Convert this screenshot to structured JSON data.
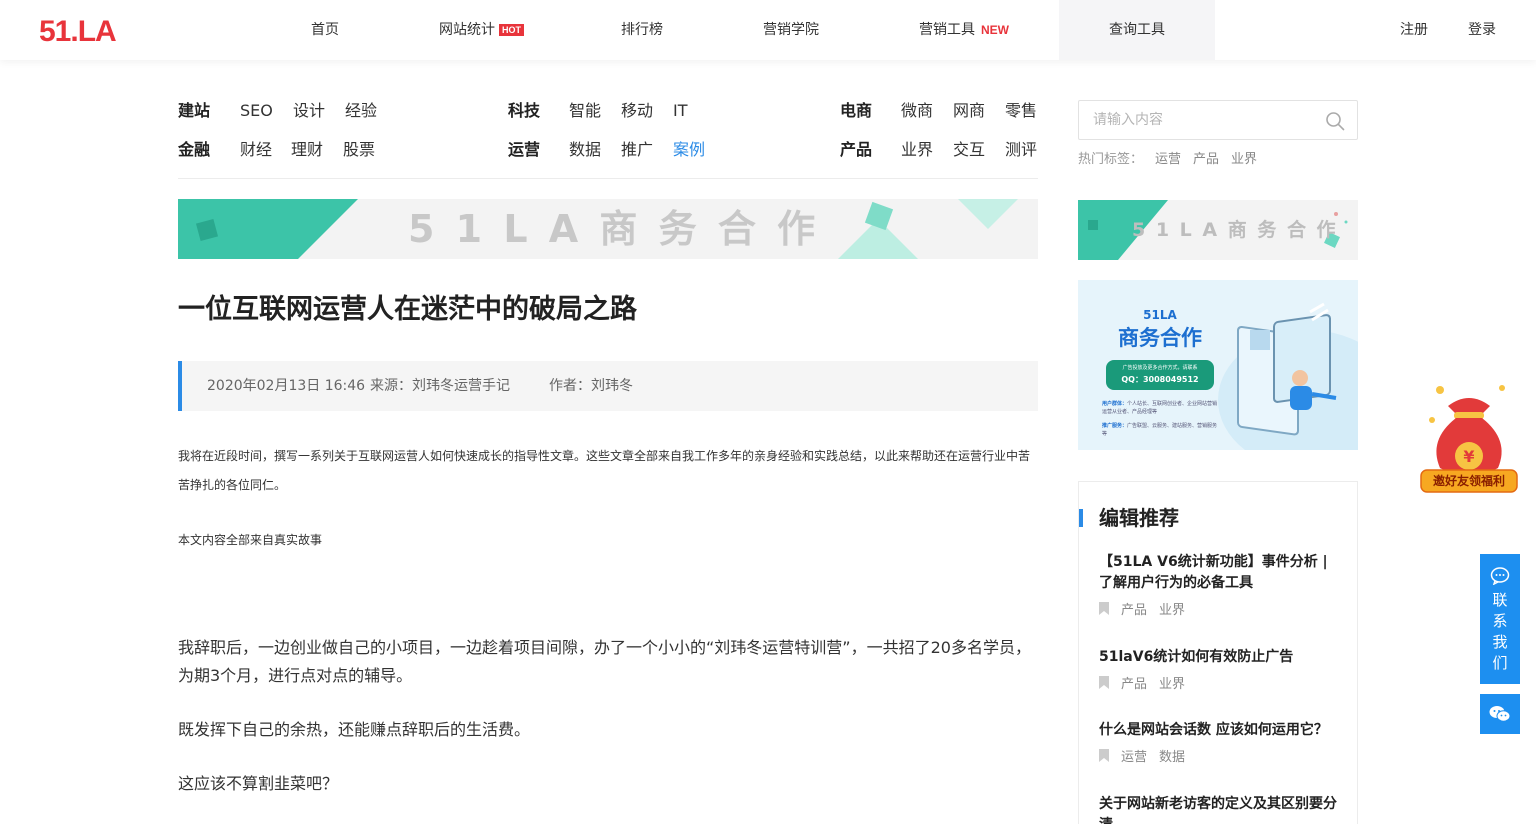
{
  "header": {
    "logo_text": "51.LA",
    "nav": [
      {
        "label": "首页"
      },
      {
        "label": "网站统计",
        "badge": "HOT"
      },
      {
        "label": "排行榜"
      },
      {
        "label": "营销学院"
      },
      {
        "label": "营销工具",
        "badge": "NEW"
      },
      {
        "label": "查询工具",
        "active": true
      }
    ],
    "register": "注册",
    "login": "登录"
  },
  "categories": [
    {
      "head": "建站",
      "subs": [
        "SEO",
        "设计",
        "经验"
      ]
    },
    {
      "head": "科技",
      "subs": [
        "智能",
        "移动",
        "IT"
      ]
    },
    {
      "head": "电商",
      "subs": [
        "微商",
        "网商",
        "零售"
      ]
    },
    {
      "head": "金融",
      "subs": [
        "财经",
        "理财",
        "股票"
      ]
    },
    {
      "head": "运营",
      "subs": [
        "数据",
        "推广",
        "案例"
      ]
    },
    {
      "head": "产品",
      "subs": [
        "业界",
        "交互",
        "测评"
      ]
    }
  ],
  "search": {
    "placeholder": "请输入内容",
    "hot_label": "热门标签：",
    "hot_tags": [
      "运营",
      "产品",
      "业界"
    ]
  },
  "banners": {
    "main_text": "5 1 L A 商 务 合 作",
    "side_text": "5 1 L A 商 务 合 作",
    "promo": {
      "brand": "51LA",
      "title": "商务合作",
      "pill": "广告投放及更多合作方式，请联系",
      "qq": "QQ：3008049512",
      "line1_label": "用户群体：",
      "line1": "个人站长、互联网创业者、企业网站营销运营从业者、产品经理等",
      "line2_label": "推广服务：",
      "line2": "广告联盟、云服务、建站服务、营销服务等"
    }
  },
  "article": {
    "title": "一位互联网运营人在迷茫中的破局之路",
    "date": "2020年02月13日 16:46",
    "source": "来源：刘玮冬运营手记",
    "author": "作者：刘玮冬",
    "intro": "我将在近段时间，撰写一系列关于互联网运营人如何快速成长的指导性文章。这些文章全部来自我工作多年的亲身经验和实践总结，以此来帮助还在运营行业中苦苦挣扎的各位同仁。",
    "note": "本文内容全部来自真实故事",
    "p1": "我辞职后，一边创业做自己的小项目，一边趁着项目间隙，办了一个小小的“刘玮冬运营特训营”，一共招了20多名学员，为期3个月，进行点对点的辅导。",
    "p2": "既发挥下自己的余热，还能赚点辞职后的生活费。",
    "p3": "这应该不算割韭菜吧？"
  },
  "recommend": {
    "title": "编辑推荐",
    "items": [
      {
        "title": "【51LA V6统计新功能】事件分析 | 了解用户行为的必备工具",
        "tags": [
          "产品",
          "业界"
        ]
      },
      {
        "title": "51laV6统计如何有效防止广告",
        "tags": [
          "产品",
          "业界"
        ]
      },
      {
        "title": "什么是网站会话数 应该如何运用它？",
        "tags": [
          "运营",
          "数据"
        ]
      },
      {
        "title": "关于网站新老访客的定义及其区别要分清",
        "tags": []
      }
    ]
  },
  "floating": {
    "gift_label": "邀好友领福利",
    "contact_chars": [
      "联",
      "系",
      "我",
      "们"
    ]
  },
  "colors": {
    "accent": "#2b8be6",
    "hot": "#e8343b",
    "logo": "#e8343b",
    "float_blue": "#1d8ff0",
    "banner_teal": "#3cc4a8"
  }
}
